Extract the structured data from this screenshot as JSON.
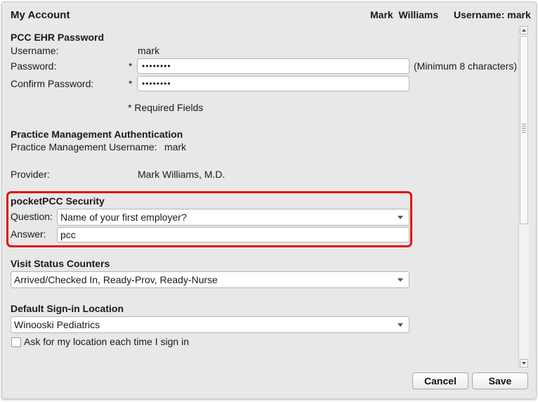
{
  "header": {
    "title": "My Account",
    "user_display_name": "Mark  Williams",
    "username_label": "Username:",
    "username_value": "mark"
  },
  "ehr_password": {
    "heading": "PCC EHR Password",
    "username_label": "Username:",
    "username_value": "mark",
    "password_label": "Password:",
    "password_value": "••••••••",
    "confirm_label": "Confirm Password:",
    "confirm_value": "••••••••",
    "required_marker": "*",
    "min_hint": "(Minimum 8 characters)",
    "required_note": "* Required Fields"
  },
  "practice_mgmt": {
    "heading": "Practice Management Authentication",
    "username_label": "Practice Management Username:",
    "username_value": "mark",
    "provider_label": "Provider:",
    "provider_value": "Mark Williams, M.D."
  },
  "pocket_security": {
    "heading": "pocketPCC Security",
    "question_label": "Question:",
    "question_value": "Name of your first employer?",
    "answer_label": "Answer:",
    "answer_value": "pcc"
  },
  "visit_status": {
    "heading": "Visit Status Counters",
    "selected": "Arrived/Checked In, Ready-Prov, Ready-Nurse"
  },
  "signin_location": {
    "heading": "Default Sign-in Location",
    "selected": "Winooski Pediatrics",
    "ask_checkbox_label": "Ask for my location each time I sign in",
    "ask_checked": false
  },
  "footer": {
    "cancel_label": "Cancel",
    "save_label": "Save"
  },
  "colors": {
    "highlight": "#e01010",
    "dialog_bg": "#e8e8e8"
  }
}
